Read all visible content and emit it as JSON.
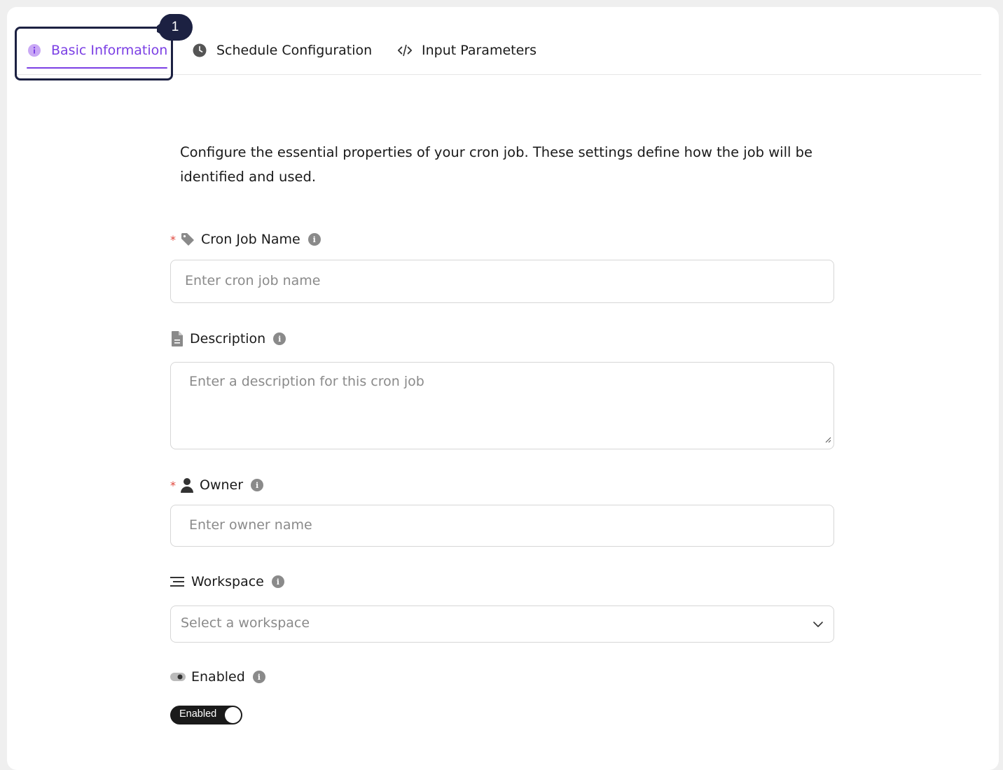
{
  "tabs": [
    {
      "label": "Basic Information",
      "icon": "info-circle-icon",
      "active": true
    },
    {
      "label": "Schedule Configuration",
      "icon": "clock-icon",
      "active": false
    },
    {
      "label": "Input Parameters",
      "icon": "code-icon",
      "active": false
    }
  ],
  "step_badge": "1",
  "intro": "Configure the essential properties of your cron job. These settings define how the job will be identified and used.",
  "fields": {
    "name": {
      "label": "Cron Job Name",
      "required_mark": "*",
      "placeholder": "Enter cron job name",
      "icon": "tag-icon"
    },
    "description": {
      "label": "Description",
      "placeholder": "Enter a description for this cron job",
      "icon": "file-icon"
    },
    "owner": {
      "label": "Owner",
      "required_mark": "*",
      "placeholder": "Enter owner name",
      "icon": "user-icon"
    },
    "workspace": {
      "label": "Workspace",
      "placeholder": "Select a workspace",
      "icon": "lines-icon"
    },
    "enabled": {
      "label": "Enabled",
      "toggle_label": "Enabled",
      "value": true,
      "icon": "toggle-icon"
    }
  },
  "info_glyph": "i",
  "colors": {
    "accent": "#7b3fe4",
    "required": "#e0463c",
    "focus": "#1c2142",
    "toggle_on": "#1a1a1a"
  }
}
